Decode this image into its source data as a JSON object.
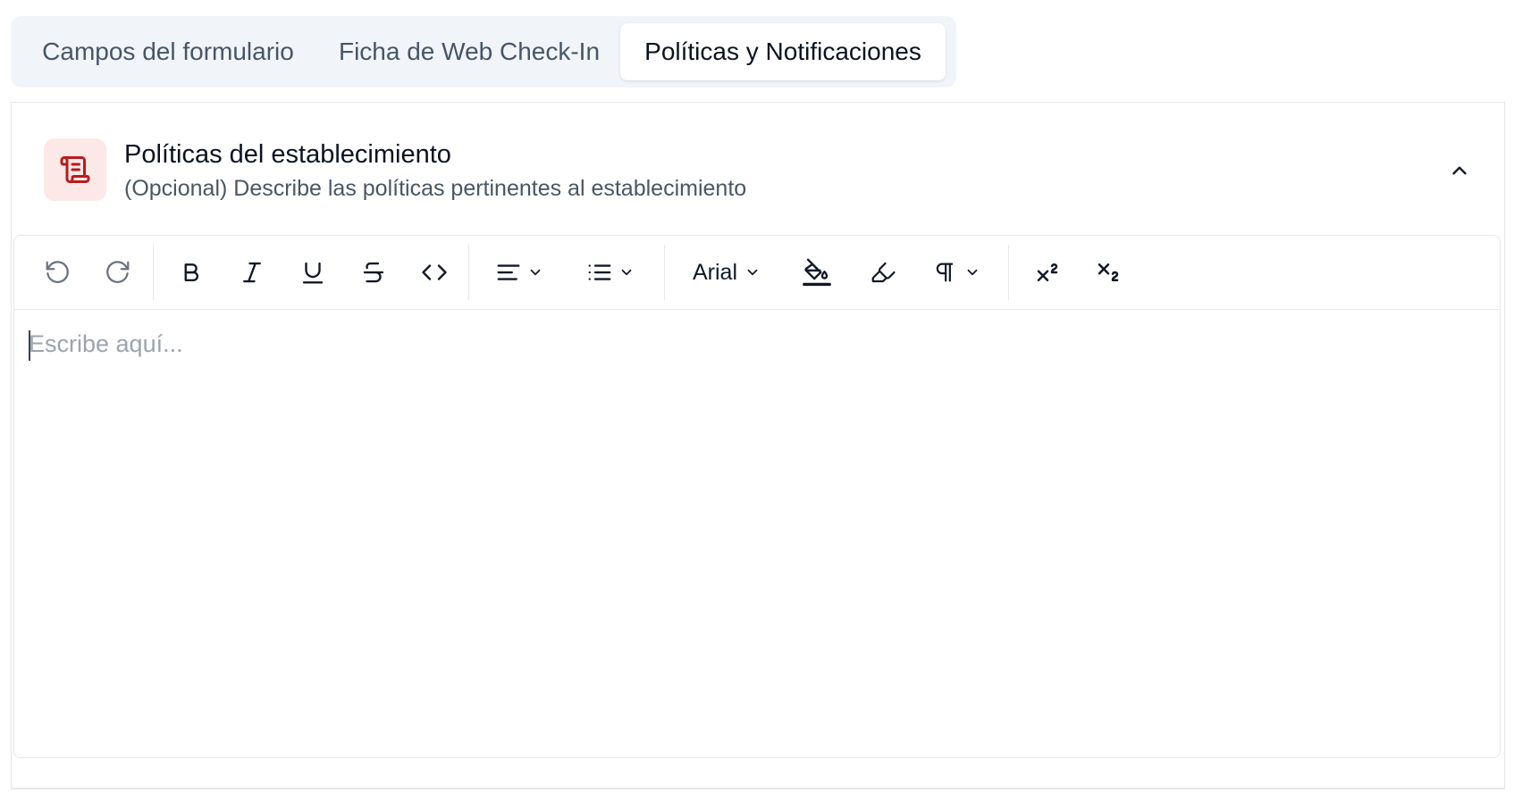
{
  "tabs": [
    {
      "label": "Campos del formulario",
      "active": false
    },
    {
      "label": "Ficha de Web Check-In",
      "active": false
    },
    {
      "label": "Políticas y Notificaciones",
      "active": true
    }
  ],
  "section": {
    "icon": "scroll-icon",
    "title": "Políticas del establecimiento",
    "subtitle": "(Opcional) Describe las políticas pertinentes al establecimiento",
    "collapse_icon": "chevron-up-icon"
  },
  "editor": {
    "toolbar": {
      "undo_icon": "undo-icon",
      "redo_icon": "redo-icon",
      "bold_icon": "bold-icon",
      "italic_icon": "italic-icon",
      "underline_icon": "underline-icon",
      "strikethrough_icon": "strikethrough-icon",
      "code_icon": "code-icon",
      "align_icon": "align-left-icon",
      "list_icon": "bullet-list-icon",
      "font_family": "Arial",
      "text_color_icon": "paint-bucket-icon",
      "highlight_icon": "highlighter-icon",
      "paragraph_icon": "pilcrow-icon",
      "superscript_icon": "superscript-icon",
      "subscript_icon": "subscript-icon"
    },
    "placeholder": "Escribe aquí..."
  },
  "colors": {
    "accent_icon": "#b91c1c",
    "accent_icon_bg": "#fde8e8",
    "tabs_bg": "#f1f5f9"
  }
}
